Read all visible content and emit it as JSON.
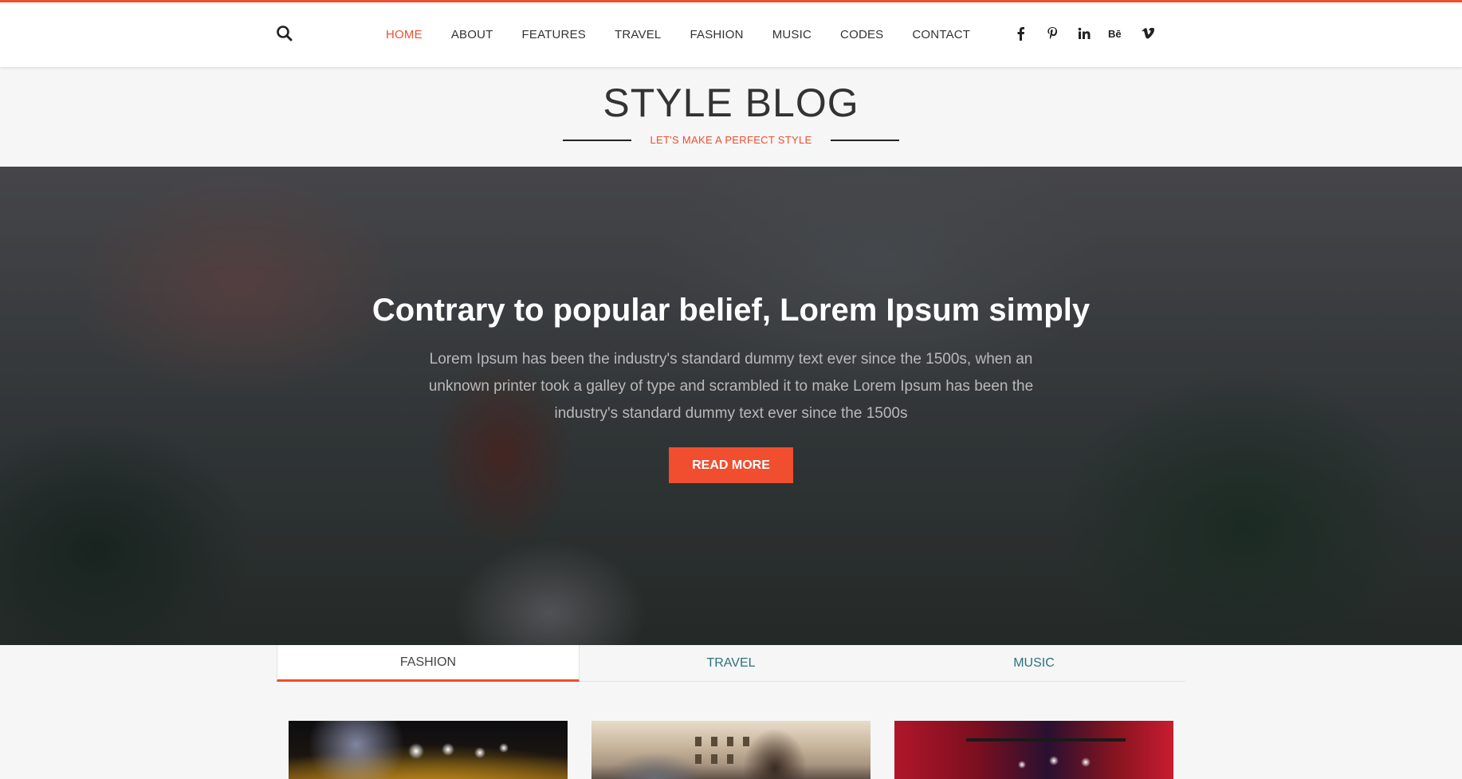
{
  "nav": {
    "items": [
      {
        "label": "HOME",
        "active": true
      },
      {
        "label": "ABOUT",
        "active": false
      },
      {
        "label": "FEATURES",
        "active": false
      },
      {
        "label": "TRAVEL",
        "active": false
      },
      {
        "label": "FASHION",
        "active": false
      },
      {
        "label": "MUSIC",
        "active": false
      },
      {
        "label": "CODES",
        "active": false
      },
      {
        "label": "CONTACT",
        "active": false
      }
    ],
    "search_icon": "search-icon",
    "social": [
      {
        "icon": "facebook-icon",
        "glyph": "f"
      },
      {
        "icon": "pinterest-icon",
        "glyph": "p"
      },
      {
        "icon": "linkedin-icon",
        "glyph": "in"
      },
      {
        "icon": "behance-icon",
        "glyph": "Bē"
      },
      {
        "icon": "vimeo-icon",
        "glyph": "v"
      }
    ]
  },
  "header": {
    "title": "STYLE BLOG",
    "tagline": "LET'S MAKE A PERFECT STYLE"
  },
  "hero": {
    "title": "Contrary to popular belief, Lorem Ipsum simply",
    "text": "Lorem Ipsum has been the industry's standard dummy text ever since the 1500s, when an unknown printer took a galley of type and scrambled it to make Lorem Ipsum has been the industry's standard dummy text ever since the 1500s",
    "button_label": "READ MORE"
  },
  "tabs": [
    {
      "label": "FASHION",
      "active": true
    },
    {
      "label": "TRAVEL",
      "active": false
    },
    {
      "label": "MUSIC",
      "active": false
    }
  ],
  "colors": {
    "accent": "#f04e2e",
    "tab_text": "#2b7380",
    "background": "#f6f6f6"
  }
}
